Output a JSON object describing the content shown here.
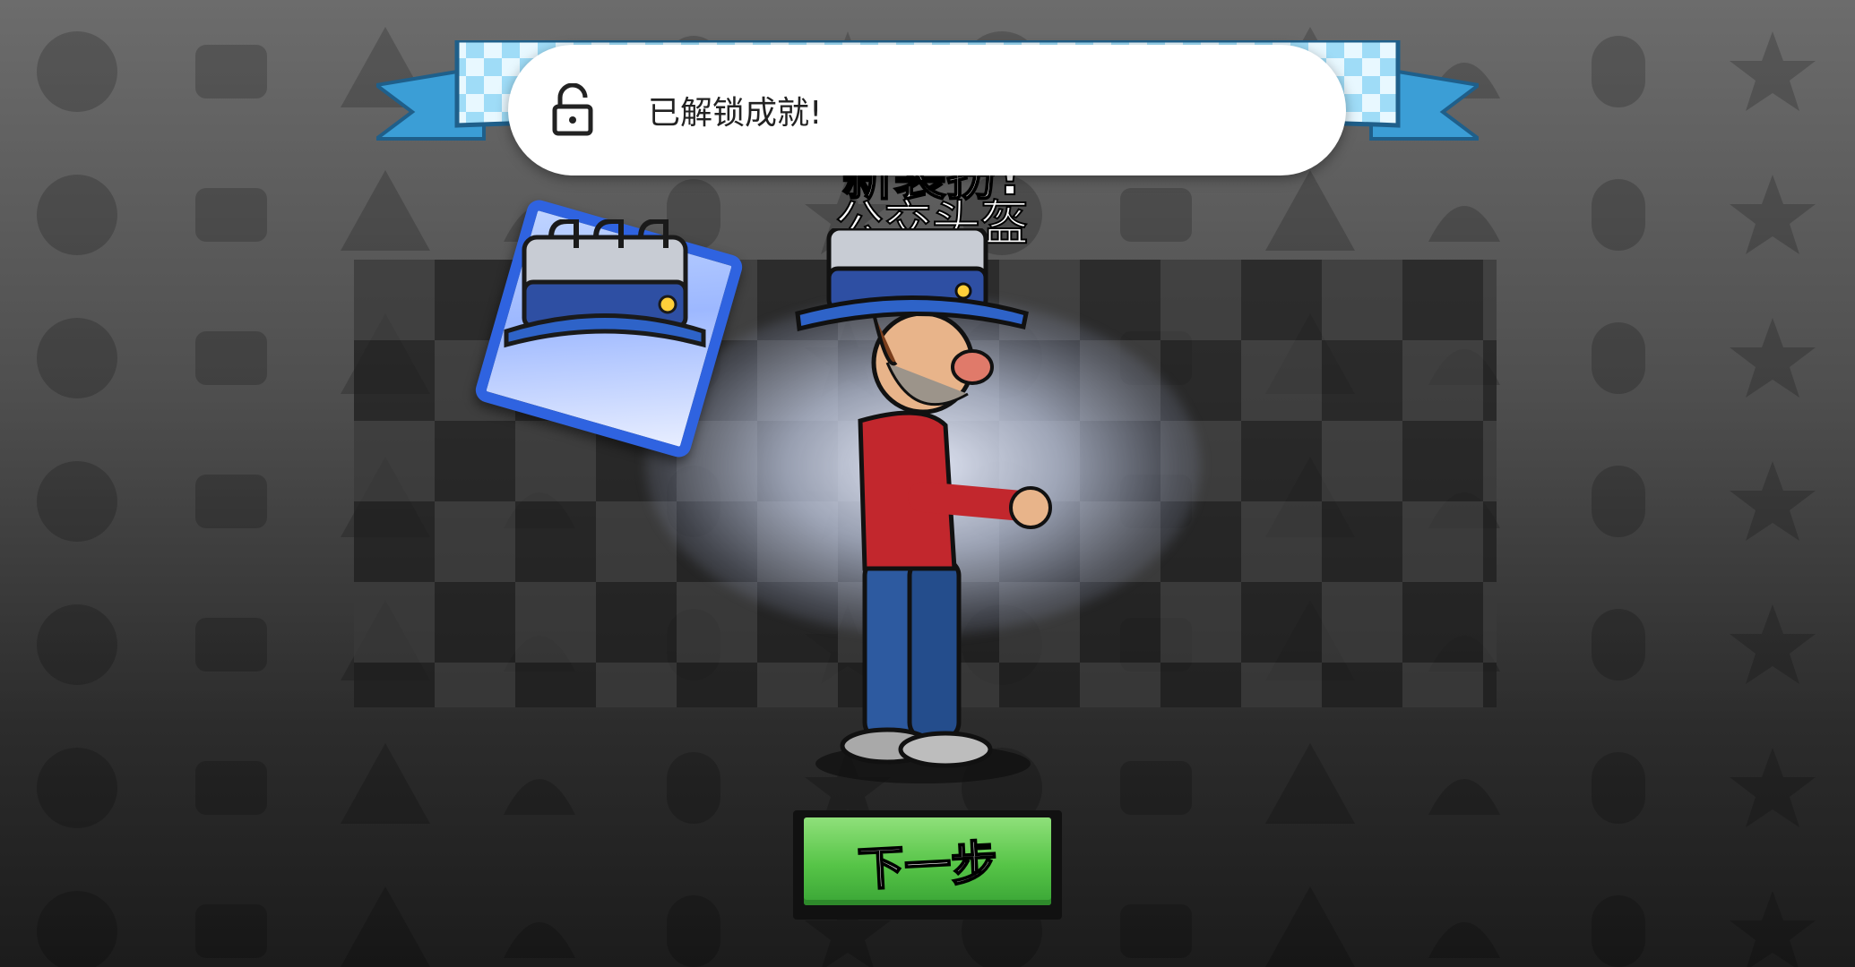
{
  "toast": {
    "icon": "lock-open-icon",
    "text": "已解锁成就!"
  },
  "reward": {
    "header": "新装扮!",
    "item_name": "公交头盔"
  },
  "next_button": {
    "label": "下一步",
    "color": "#56c447"
  },
  "colors": {
    "ribbon": "#4fb3e8",
    "card_border": "#2f63e0",
    "toast_bg": "#ffffff"
  }
}
